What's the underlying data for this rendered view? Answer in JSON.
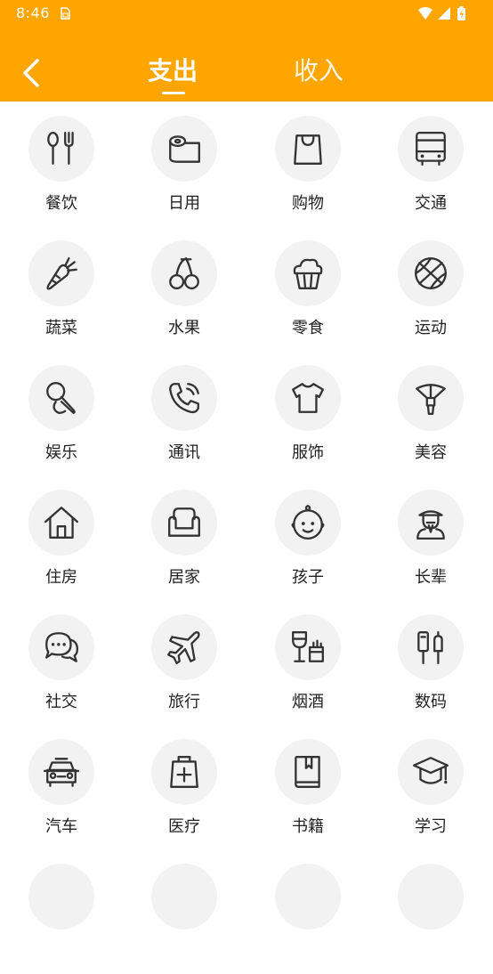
{
  "status_bar": {
    "time": "8:46"
  },
  "header": {
    "tabs": [
      {
        "label": "支出",
        "active": true
      },
      {
        "label": "收入",
        "active": false
      }
    ]
  },
  "categories": [
    {
      "label": "餐饮",
      "icon": "utensils-icon"
    },
    {
      "label": "日用",
      "icon": "tissue-roll-icon"
    },
    {
      "label": "购物",
      "icon": "shopping-bag-icon"
    },
    {
      "label": "交通",
      "icon": "bus-icon"
    },
    {
      "label": "蔬菜",
      "icon": "carrot-icon"
    },
    {
      "label": "水果",
      "icon": "cherry-icon"
    },
    {
      "label": "零食",
      "icon": "cupcake-icon"
    },
    {
      "label": "运动",
      "icon": "basketball-icon"
    },
    {
      "label": "娱乐",
      "icon": "microphone-icon"
    },
    {
      "label": "通讯",
      "icon": "phone-icon"
    },
    {
      "label": "服饰",
      "icon": "tshirt-icon"
    },
    {
      "label": "美容",
      "icon": "beauty-icon"
    },
    {
      "label": "住房",
      "icon": "house-icon"
    },
    {
      "label": "居家",
      "icon": "sofa-icon"
    },
    {
      "label": "孩子",
      "icon": "baby-icon"
    },
    {
      "label": "长辈",
      "icon": "elder-icon"
    },
    {
      "label": "社交",
      "icon": "chat-icon"
    },
    {
      "label": "旅行",
      "icon": "airplane-icon"
    },
    {
      "label": "烟酒",
      "icon": "wine-icon"
    },
    {
      "label": "数码",
      "icon": "usb-icon"
    },
    {
      "label": "汽车",
      "icon": "car-icon"
    },
    {
      "label": "医疗",
      "icon": "medical-kit-icon"
    },
    {
      "label": "书籍",
      "icon": "book-icon"
    },
    {
      "label": "学习",
      "icon": "graduation-cap-icon"
    },
    {
      "label": "",
      "icon": "more-icon"
    },
    {
      "label": "",
      "icon": "more-icon"
    },
    {
      "label": "",
      "icon": "more-icon"
    },
    {
      "label": "",
      "icon": "more-icon"
    }
  ]
}
